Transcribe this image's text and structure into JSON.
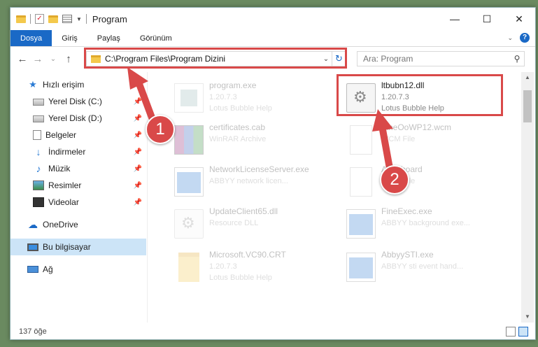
{
  "titlebar": {
    "title": "Program",
    "minimize": "—",
    "maximize": "☐",
    "close": "✕"
  },
  "ribbon": {
    "tabs": [
      {
        "label": "Dosya",
        "active": true
      },
      {
        "label": "Giriş"
      },
      {
        "label": "Paylaş"
      },
      {
        "label": "Görünüm"
      }
    ],
    "help": "?"
  },
  "nav": {
    "back": "←",
    "forward": "→",
    "recent": "⌄",
    "up": "↑",
    "address": "C:\\Program Files\\Program Dizini",
    "search_placeholder": "Ara: Program"
  },
  "sidebar": {
    "items": [
      {
        "label": "Hızlı erişim",
        "icon": "star-icon"
      },
      {
        "label": "Yerel Disk (C:)",
        "icon": "disk-icon",
        "pinned": true
      },
      {
        "label": "Yerel Disk (D:)",
        "icon": "disk-icon",
        "pinned": true
      },
      {
        "label": "Belgeler",
        "icon": "document-icon",
        "pinned": true
      },
      {
        "label": "İndirmeler",
        "icon": "download-icon",
        "pinned": true
      },
      {
        "label": "Müzik",
        "icon": "music-icon",
        "pinned": true
      },
      {
        "label": "Resimler",
        "icon": "pictures-icon",
        "pinned": true
      },
      {
        "label": "Videolar",
        "icon": "video-icon",
        "pinned": true
      },
      {
        "label": "OneDrive",
        "icon": "cloud-icon"
      },
      {
        "label": "Bu bilgisayar",
        "icon": "computer-icon",
        "selected": true
      },
      {
        "label": "Ağ",
        "icon": "network-icon"
      }
    ]
  },
  "files": [
    {
      "name": "program.exe",
      "line2": "1.20.7.3",
      "line3": "Lotus Bubble Help",
      "icon": "exe-icon",
      "faded": true
    },
    {
      "name": "ltbubn12.dll",
      "line2": "1.20.7.3",
      "line3": "Lotus Bubble Help",
      "icon": "gear-file-icon",
      "faded": false
    },
    {
      "name": "certificates.cab",
      "line2": "WinRAR Archive",
      "line3": "",
      "icon": "archive-icon",
      "faded": true
    },
    {
      "name": "FineOoWP12.wcm",
      "line2": "WCM File",
      "line3": "",
      "icon": "blank-file-icon",
      "faded": true
    },
    {
      "name": "NetworkLicenseServer.exe",
      "line2": "ABBYY network licen...",
      "line3": "",
      "icon": "window-icon",
      "faded": true
    },
    {
      "name": "Aras board",
      "line2": "WCM File",
      "line3": "",
      "icon": "blank-file-icon",
      "faded": true
    },
    {
      "name": "UpdateClient65.dll",
      "line2": "Resource DLL",
      "line3": "",
      "icon": "gear-file-icon",
      "faded": true
    },
    {
      "name": "FineExec.exe",
      "line2": "ABBYY background exe...",
      "line3": "",
      "icon": "window-icon",
      "faded": true
    },
    {
      "name": "Microsoft.VC90.CRT",
      "line2": "1.20.7.3",
      "line3": "Lotus Bubble Help",
      "icon": "folder-icon",
      "faded": true
    },
    {
      "name": "AbbyySTI.exe",
      "line2": "ABBYY sti event hand...",
      "line3": "",
      "icon": "window-icon",
      "faded": true
    }
  ],
  "status": {
    "count": "137 öğe"
  },
  "annotations": {
    "badge1": "1",
    "badge2": "2"
  },
  "colors": {
    "accent": "#1a69c6",
    "highlight": "#d94949",
    "selected": "#cce4f7"
  }
}
